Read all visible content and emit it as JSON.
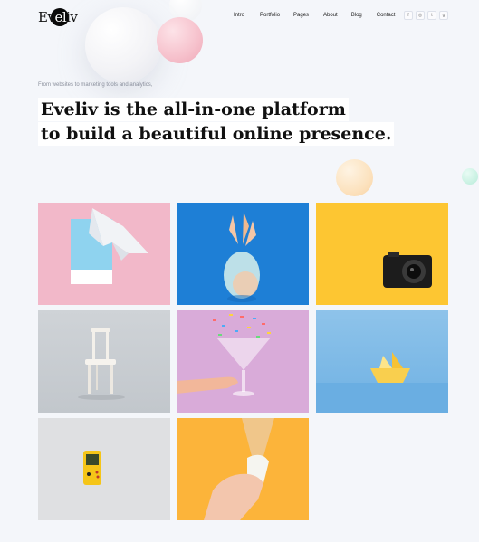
{
  "brand": {
    "logo_prefix": "Ev",
    "logo_highlight": "el",
    "logo_suffix": "iv"
  },
  "nav": {
    "items": [
      "Intro",
      "Portfolio",
      "Pages",
      "About",
      "Blog",
      "Contact"
    ]
  },
  "social": [
    "f",
    "◎",
    "t",
    "g"
  ],
  "hero": {
    "eyebrow": "From websites to marketing tools and analytics,",
    "headline_line1": "Eveliv is the all-in-one platform",
    "headline_line2": "to build a beautiful online presence."
  },
  "portfolio": {
    "items": [
      {
        "subject": "origami-bird",
        "color": "#f2b8c9"
      },
      {
        "subject": "pineapple",
        "color": "#1e7fd6"
      },
      {
        "subject": "camera",
        "color": "#fdc632"
      },
      {
        "subject": "chair",
        "color": "#c9cdd2"
      },
      {
        "subject": "sprinkles-glass",
        "color": "#d9abd9"
      },
      {
        "subject": "paper-boat",
        "color": "#7fbbe7"
      },
      {
        "subject": "game-console",
        "color": "#dfe0e2"
      },
      {
        "subject": "ice-cream-cone",
        "color": "#fcb43a"
      }
    ]
  }
}
